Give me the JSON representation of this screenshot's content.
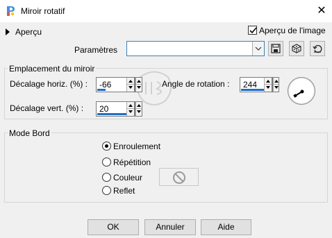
{
  "window": {
    "title": "Miroir rotatif",
    "close_glyph": "✕"
  },
  "preview": {
    "toggle_label": "Aperçu",
    "checkbox_label": "Aperçu de l'image",
    "checked": true
  },
  "presets": {
    "label": "Paramètres",
    "value": ""
  },
  "mirror_group": {
    "title": "Emplacement du miroir",
    "horiz_label": "Décalage horiz. (%) :",
    "horiz_value": "-66",
    "vert_label": "Décalage vert. (%) :",
    "vert_value": "20",
    "angle_label": "Angle de rotation :",
    "angle_value": "244"
  },
  "edge_group": {
    "title": "Mode Bord",
    "options": [
      "Enroulement",
      "Répétition",
      "Couleur",
      "Reflet"
    ],
    "selected": "Enroulement"
  },
  "buttons": {
    "ok": "OK",
    "cancel": "Annuler",
    "help": "Aide"
  },
  "colors": {
    "accent": "#1e6fc4",
    "background": "#f0f0f0"
  },
  "icons": [
    "paintshop-icon",
    "save-icon",
    "dice-icon",
    "reset-icon",
    "no-color-icon",
    "watermark-logo"
  ]
}
